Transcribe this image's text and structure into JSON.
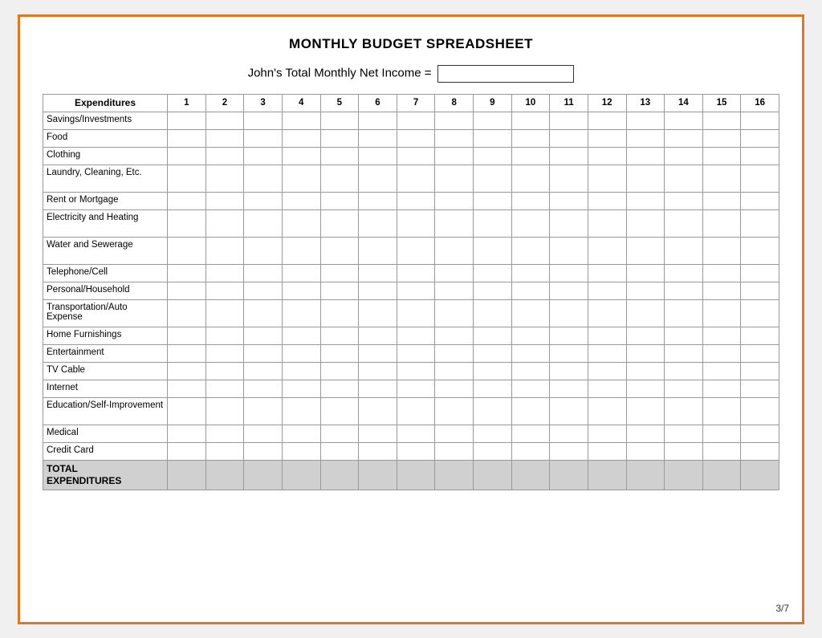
{
  "title": "MONTHLY BUDGET SPREADSHEET",
  "income_label": "John's Total Monthly Net Income =",
  "income_value": "",
  "columns": [
    "Expenditures",
    "1",
    "2",
    "3",
    "4",
    "5",
    "6",
    "7",
    "8",
    "9",
    "10",
    "11",
    "12",
    "13",
    "14",
    "15",
    "16"
  ],
  "rows": [
    {
      "label": "Savings/Investments",
      "tall": false
    },
    {
      "label": "Food",
      "tall": false
    },
    {
      "label": "Clothing",
      "tall": false
    },
    {
      "label": "Laundry, Cleaning, Etc.",
      "tall": true
    },
    {
      "label": "Rent or Mortgage",
      "tall": false
    },
    {
      "label": "Electricity and Heating",
      "tall": true
    },
    {
      "label": "Water and Sewerage",
      "tall": true
    },
    {
      "label": "Telephone/Cell",
      "tall": false
    },
    {
      "label": "Personal/Household",
      "tall": false
    },
    {
      "label": "Transportation/Auto Expense",
      "tall": true
    },
    {
      "label": "Home Furnishings",
      "tall": false
    },
    {
      "label": "Entertainment",
      "tall": false
    },
    {
      "label": "TV Cable",
      "tall": false
    },
    {
      "label": "Internet",
      "tall": false
    },
    {
      "label": "Education/Self-Improvement",
      "tall": true
    },
    {
      "label": "Medical",
      "tall": false
    },
    {
      "label": "Credit Card",
      "tall": false
    }
  ],
  "total_row_label": "TOTAL EXPENDITURES",
  "page_number": "3/7"
}
